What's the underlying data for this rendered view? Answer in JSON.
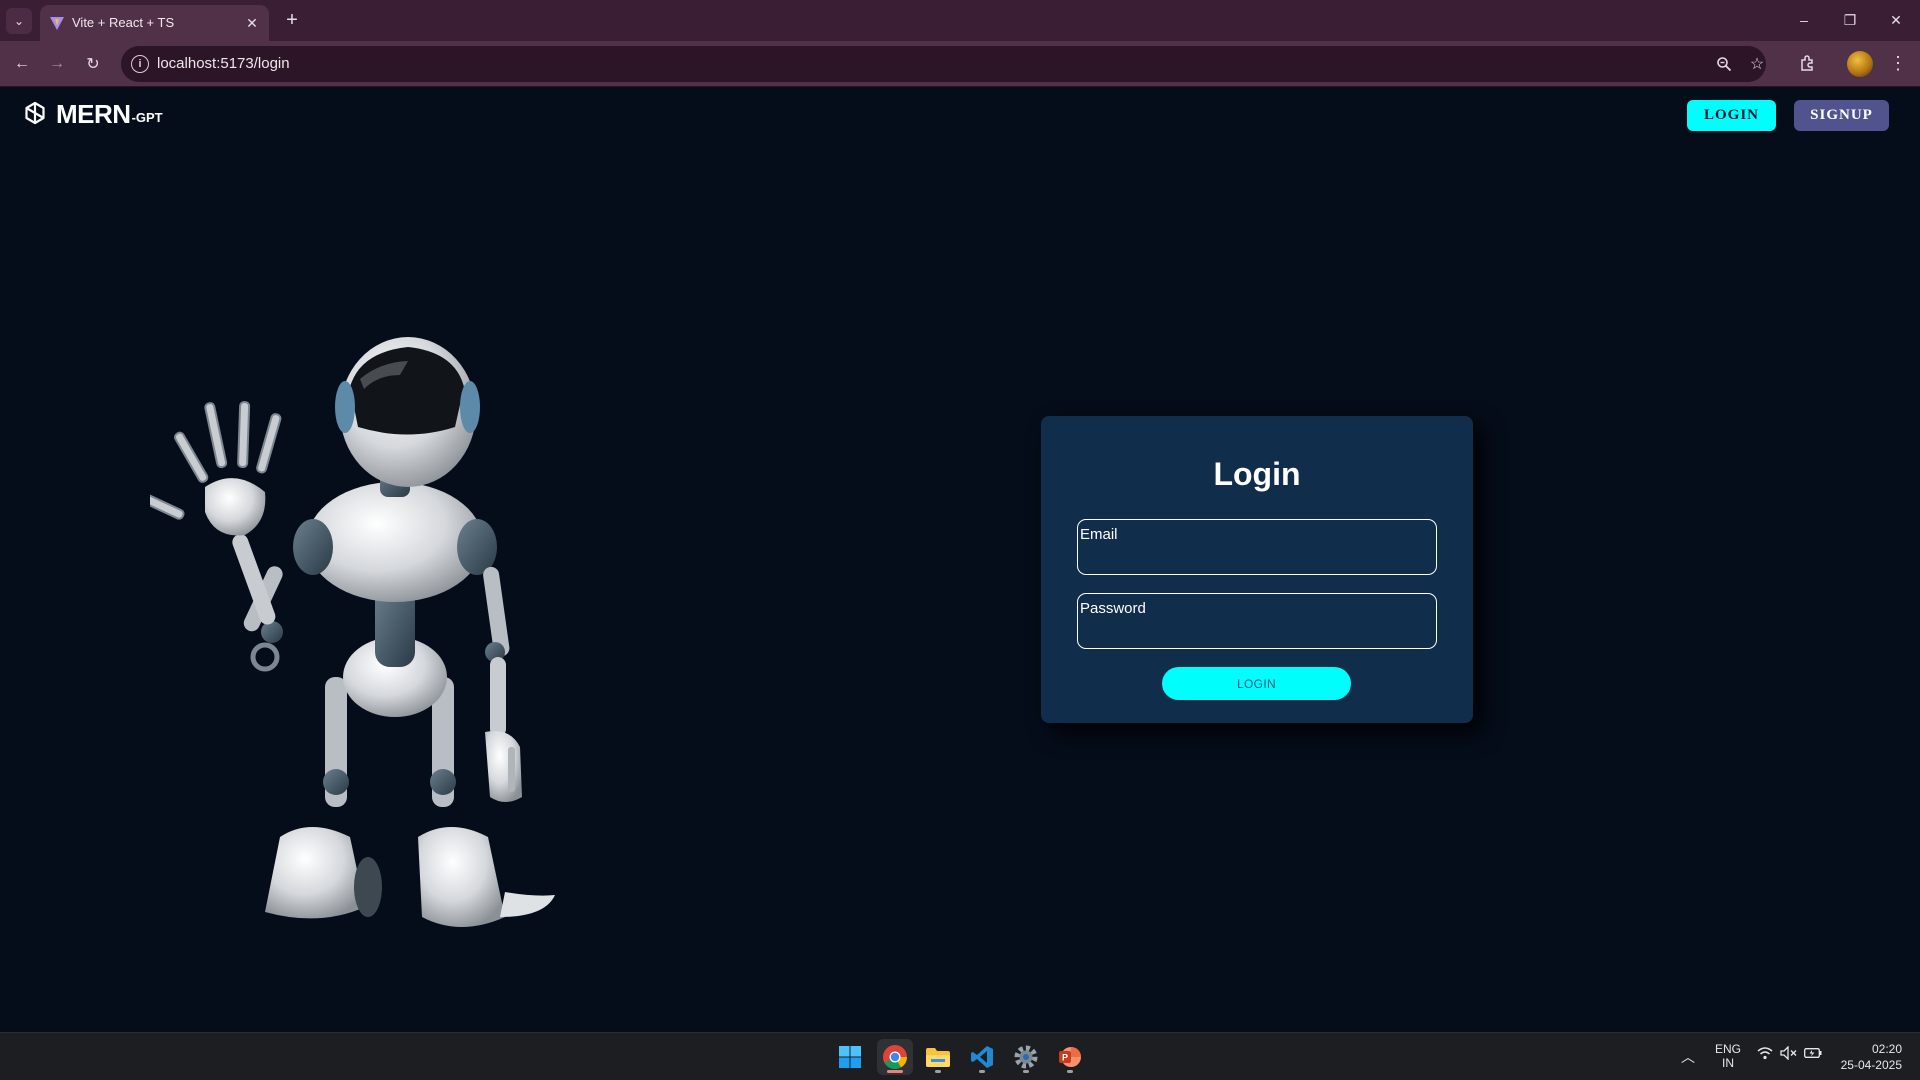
{
  "browser": {
    "tab_title": "Vite + React + TS",
    "url": "localhost:5173/login",
    "window_controls": {
      "minimize": "–",
      "restore": "❐",
      "close": "✕"
    }
  },
  "header": {
    "logo_text": "MERN",
    "logo_suffix": "-GPT",
    "login_label": "LOGIN",
    "signup_label": "SIGNUP"
  },
  "login_form": {
    "title": "Login",
    "email_label": "Email",
    "password_label": "Password",
    "submit_label": "LOGIN"
  },
  "taskbar": {
    "apps": [
      "start-icon",
      "chrome-icon",
      "file-explorer-icon",
      "vscode-icon",
      "settings-icon",
      "powerpoint-icon"
    ],
    "language_line1": "ENG",
    "language_line2": "IN",
    "time": "02:20",
    "date": "25-04-2025"
  },
  "colors": {
    "page_bg": "#050d1a",
    "card_bg": "#102d4b",
    "accent_cyan": "#00fffc",
    "signup_bg": "#51538f",
    "browser_frame": "#3a1e33"
  }
}
